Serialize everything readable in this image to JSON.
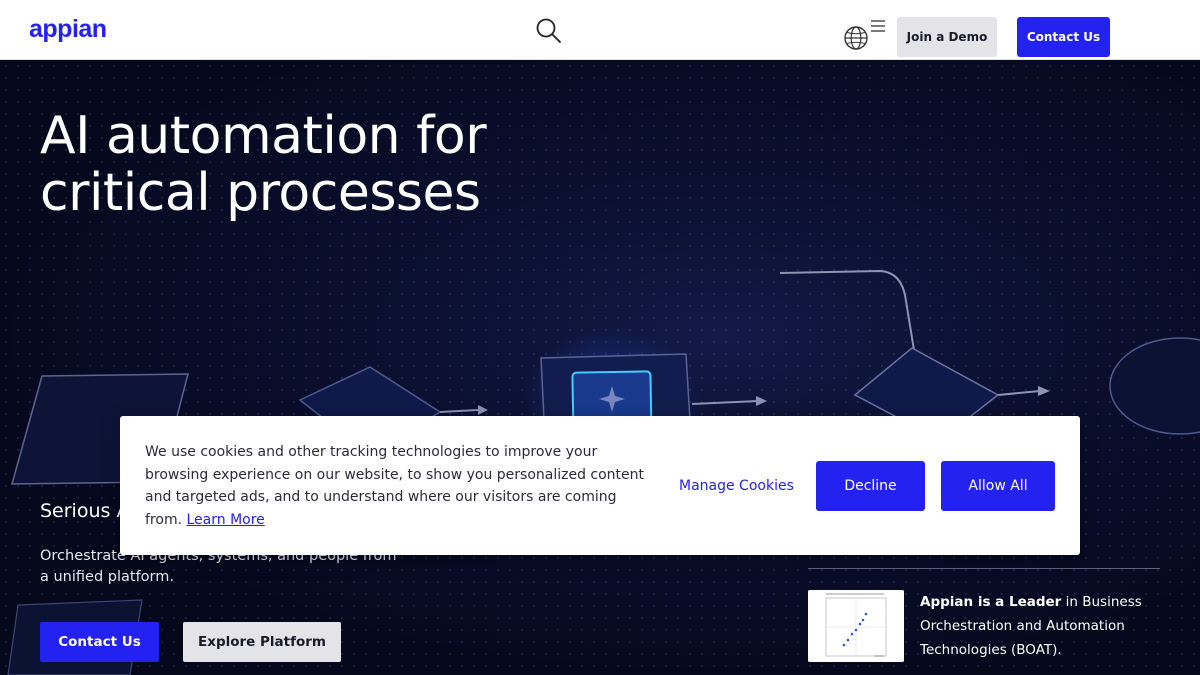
{
  "header": {
    "logo_text": "appian",
    "search_icon": "search-icon",
    "globe_icon": "globe-icon",
    "menu_icon": "menu-icon",
    "join_demo_label": "Join a Demo",
    "contact_label": "Contact Us"
  },
  "hero": {
    "title_line1": "AI automation for",
    "title_line2": "critical processes",
    "subtitle": "Serious AI",
    "description": "Orchestrate AI agents, systems, and people from a unified platform.",
    "contact_label": "Contact Us",
    "explore_label": "Explore Platform"
  },
  "report": {
    "bold_text": "Appian is a Leader",
    "rest_text": " in Business Orchestration and Automation Technologies (BOAT)."
  },
  "cookie_banner": {
    "text": "We use cookies and other tracking technologies to improve your browsing experience on our website, to show you personalized content and targeted ads, and to understand where our visitors are coming from.",
    "learn_more": "Learn More",
    "manage_label": "Manage Cookies",
    "decline_label": "Decline",
    "allow_label": "Allow All"
  },
  "colors": {
    "brand": "#2322f0",
    "hero_bg": "#070a1e",
    "light_button": "#e4e4e8"
  }
}
